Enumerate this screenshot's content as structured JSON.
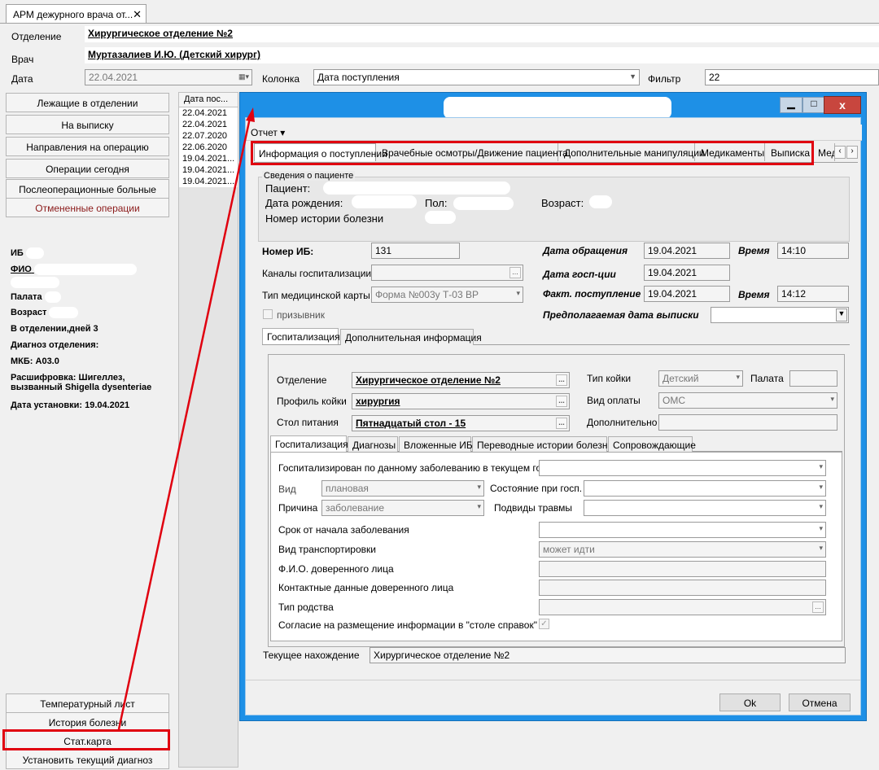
{
  "window_tab": {
    "title": "АРМ дежурного врача от...",
    "close": "✕"
  },
  "header": {
    "department_label": "Отделение",
    "department_value": "Хирургическое отделение №2",
    "doctor_label": "Врач",
    "doctor_value": "Муртазалиев И.Ю. (Детский хирург)",
    "date_label": "Дата",
    "date_value": "22.04.2021",
    "column_label": "Колонка",
    "column_value": "Дата поступления",
    "filter_label": "Фильтр",
    "filter_value": "22"
  },
  "left_nav": {
    "items": [
      "Лежащие в отделении",
      "На выписку",
      "Направления на операцию",
      "Операции сегодня",
      "Послеоперационные больные",
      "Отмененные операции"
    ],
    "bottom_items": [
      "Температурный лист",
      "История болезни",
      "Стат.карта",
      "Установить текущий диагноз"
    ]
  },
  "patient_info": {
    "ib_label": "ИБ",
    "fio_label": "ФИО",
    "ward_label": "Палата",
    "age_label": "Возраст",
    "days": "В отделении,дней 3",
    "diagnosis_label": "Диагноз отделения:",
    "mkb": "МКБ: A03.0",
    "decode": "Расшифровка: Шигеллез, вызванный Shigella dysenteriae",
    "install_date": "Дата установки: 19.04.2021"
  },
  "grid": {
    "header": "Дата пос...",
    "rows": [
      "22.04.2021",
      "22.04.2021",
      "22.07.2020",
      "22.06.2020",
      "19.04.2021...",
      "19.04.2021...",
      "19.04.2021..."
    ]
  },
  "dialog": {
    "menu": "Отчет",
    "tabs": [
      "Информация о поступлении",
      "Врачебные осмотры/Движение пациента",
      "Дополнительные манипуляции",
      "Медикаменты",
      "Выписка",
      "Мед"
    ],
    "patient_group": "Сведения о пациенте",
    "patient_label": "Пациент:",
    "birth_label": "Дата рождения:",
    "sex_label": "Пол:",
    "age_label": "Возраст:",
    "history_label": "Номер истории болезни",
    "ib_num_label": "Номер ИБ:",
    "ib_num_value": "131",
    "channels_label": "Каналы госпитализации",
    "card_type_label": "Тип медицинской карты",
    "card_type_value": "Форма №003у Т-03 ВР",
    "conscript_label": "призывник",
    "appeal_date_label": "Дата обращения",
    "appeal_date_value": "19.04.2021",
    "time_label": "Время",
    "appeal_time_value": "14:10",
    "hosp_date_label": "Дата госп-ции",
    "hosp_date_value": "19.04.2021",
    "fact_label": "Факт. поступление",
    "fact_date_value": "19.04.2021",
    "fact_time_value": "14:12",
    "discharge_label": "Предполагаемая дата выписки",
    "sub_tabs": [
      "Госпитализация",
      "Дополнительная информация"
    ],
    "dept_label": "Отделение",
    "dept_value": "Хирургическое отделение №2",
    "bed_profile_label": "Профиль койки",
    "bed_profile_value": "хирургия",
    "table_label": "Стол питания",
    "table_value": "Пятнадцатый стол - 15",
    "bed_type_label": "Тип койки",
    "bed_type_value": "Детский",
    "ward_label": "Палата",
    "payment_label": "Вид оплаты",
    "payment_value": "ОМС",
    "extra_label": "Дополнительно",
    "inner_tabs": [
      "Госпитализация",
      "Диагнозы",
      "Вложенные ИБ",
      "Переводные истории болезни",
      "Сопровождающие"
    ],
    "q_same_disease": "Госпитализирован по данному заболеванию в текущем году",
    "kind_label": "Вид",
    "kind_value": "плановая",
    "state_label": "Состояние при госп.",
    "reason_label": "Причина",
    "reason_value": "заболевание",
    "trauma_label": "Подвиды травмы",
    "term_label": "Срок от начала заболевания",
    "transport_label": "Вид транспортировки",
    "transport_value": "может идти",
    "trustee_label": "Ф.И.О. доверенного лица",
    "contacts_label": "Контактные данные доверенного лица",
    "relation_label": "Тип родства",
    "consent_label": "Согласие на размещение информации в \"столе справок\"",
    "current_label": "Текущее нахождение",
    "current_value": "Хирургическое отделение №2",
    "ok": "Ok",
    "cancel": "Отмена"
  },
  "colors": {
    "titlebar": "#1e90e6",
    "highlight": "#e0000f",
    "close": "#c8463e"
  }
}
